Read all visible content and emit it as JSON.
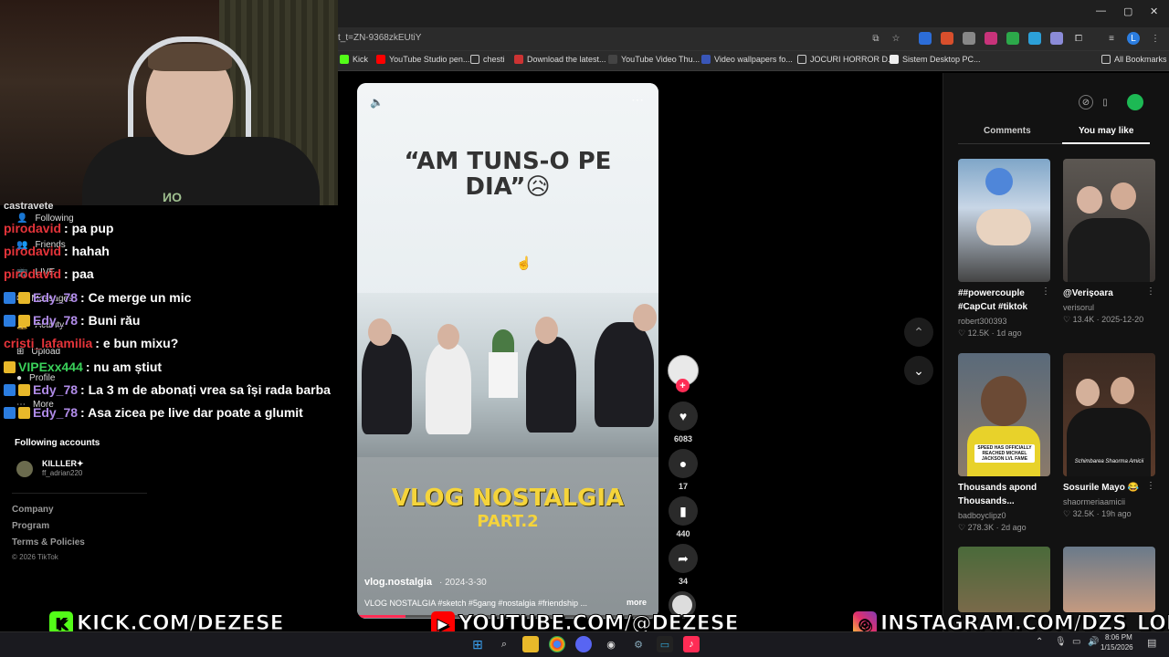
{
  "browser": {
    "url": "t_t=ZN-9368zkEUtiY",
    "bookmarks": [
      "Kick",
      "YouTube Studio pen...",
      "chesti",
      "Download the latest...",
      "YouTube Video Thu...",
      "Video wallpapers fo...",
      "JOCURI HORROR D...",
      "Sistem Desktop PC..."
    ],
    "all_bookmarks": "All Bookmarks",
    "profile_initial": "L"
  },
  "sidebar": {
    "top_label": "castravete",
    "nav": [
      "Following",
      "Friends",
      "LIVE",
      "Messages",
      "Activity",
      "Upload",
      "Profile",
      "More"
    ],
    "following_header": "Following accounts",
    "account_name": "KILLLER✦",
    "account_handle": "ff_adrian220",
    "footer": [
      "Company",
      "Program",
      "Terms & Policies"
    ],
    "copyright": "© 2026 TikTok"
  },
  "chat": [
    {
      "user": "pirodavid",
      "text": ": pa pup"
    },
    {
      "user": "pirodavid",
      "text": ": hahah"
    },
    {
      "user": "pirodavid",
      "text": ": paa"
    },
    {
      "user": "Edy_78",
      "text": ": Ce merge un mic"
    },
    {
      "user": "Edy_78",
      "text": ": Buni rău"
    },
    {
      "user": "cristi_lafamilia",
      "text": ": e bun mixu?"
    },
    {
      "user": "VIPExx444",
      "text": ": nu am știut"
    },
    {
      "user": "Edy_78",
      "text": ": La 3 m de abonați vrea sa își rada barba"
    },
    {
      "user": "Edy_78",
      "text": ": Asa zicea pe live dar poate a glumit"
    }
  ],
  "video": {
    "quote": "“AM TUNS-O PE DIA”😥",
    "title": "VLOG NOSTALGIA",
    "part": "PART.2",
    "author": "vlog.nostalgia",
    "date": "· 2024-3-30",
    "description": "VLOG NOSTALGIA #sketch #5gang #nostalgia #friendship ...",
    "more": "more",
    "progress": 0.16
  },
  "actions": {
    "likes": "6083",
    "comments": "17",
    "saves": "440",
    "shares": "34"
  },
  "right_panel": {
    "tabs": [
      "Comments",
      "You may like"
    ],
    "items": [
      {
        "title": "##powercouple #CapCut #tiktok",
        "user": "robert300393",
        "meta": "♡ 12.5K · 1d ago"
      },
      {
        "title": "@Verișoara",
        "user": "verisorul",
        "meta": "♡ 13.4K · 2025-12-20"
      },
      {
        "title": "Thousands apond Thousands...",
        "user": "badboyclipz0",
        "meta": "♡ 278.3K · 2d ago"
      },
      {
        "title": "Sosurile Mayo 😂",
        "user": "shaormeriaamicii",
        "meta": "♡ 32.5K · 19h ago"
      }
    ],
    "thumb3_caption": "SPEED HAS OFFICIALLY REACHED MICHAEL JACKSON LVL FAME",
    "thumb4_caption": "Schimbarea Shaorma Amicii"
  },
  "overlays": {
    "kick": "KICK.COM/DEZESE",
    "youtube": "YOUTUBE.COM/@DEZESE",
    "instagram": "INSTAGRAM.COM/DZS_LORI"
  },
  "taskbar": {
    "time": "8:06 PM",
    "date": "1/15/2026"
  },
  "colors": {
    "accent": "#fe2c55",
    "kick": "#53fc18",
    "youtube": "#ff0000"
  }
}
